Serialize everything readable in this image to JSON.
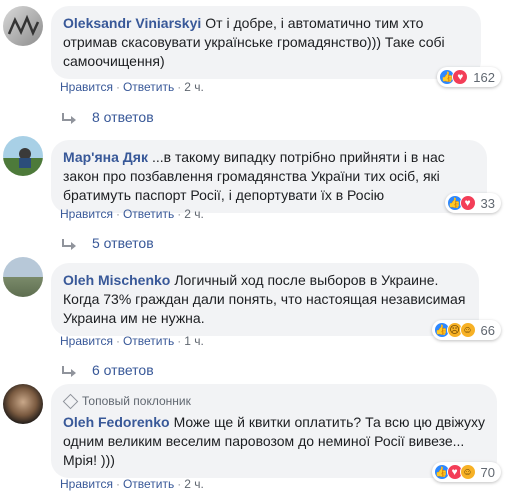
{
  "comments": [
    {
      "author": "Oleksandr Viniarskyi",
      "text": "От і добре, і автоматично тим хто отримав скасовувати українське громадянство))) Таке собі самоочищення)",
      "reaction_count": "162",
      "reactions": [
        "like-icon",
        "love-icon"
      ],
      "actions": {
        "like": "Нравится",
        "reply": "Ответить",
        "time": "2 ч."
      },
      "replies": "8 ответов"
    },
    {
      "author": "Мар'яна Дяк",
      "text": "...в такому випадку потрібно прийняти і в нас закон про позбавлення громадянства України тих осіб, які братимуть паспорт Росії, і депортувати їх в Росію",
      "reaction_count": "33",
      "reactions": [
        "like-icon",
        "love-icon"
      ],
      "actions": {
        "like": "Нравится",
        "reply": "Ответить",
        "time": "2 ч."
      },
      "replies": "5 ответов"
    },
    {
      "author": "Oleh Mischenko",
      "text": "Логичный ход после выборов в Украине. Когда 73% граждан дали понять, что настоящая независимая Украина им не нужна.",
      "reaction_count": "66",
      "reactions": [
        "like-icon",
        "sad-icon",
        "haha-icon"
      ],
      "actions": {
        "like": "Нравится",
        "reply": "Ответить",
        "time": "1 ч."
      },
      "replies": "6 ответов"
    },
    {
      "badge": "Топовый поклонник",
      "author": "Oleh Fedorenko",
      "text": "Може ще й квитки оплатить? Та всю цю двіжуху одним великим веселим паровозом до неминої Росії вивезе... Мрія! )))",
      "reaction_count": "70",
      "reactions": [
        "like-icon",
        "love-icon",
        "haha-icon"
      ],
      "actions": {
        "like": "Нравится",
        "reply": "Ответить",
        "time": "2 ч."
      }
    }
  ],
  "colors": {
    "link": "#385898",
    "bubble": "#f2f3f5",
    "like": "#2d88ff",
    "love": "#f33e58",
    "haha": "#f7b125"
  }
}
